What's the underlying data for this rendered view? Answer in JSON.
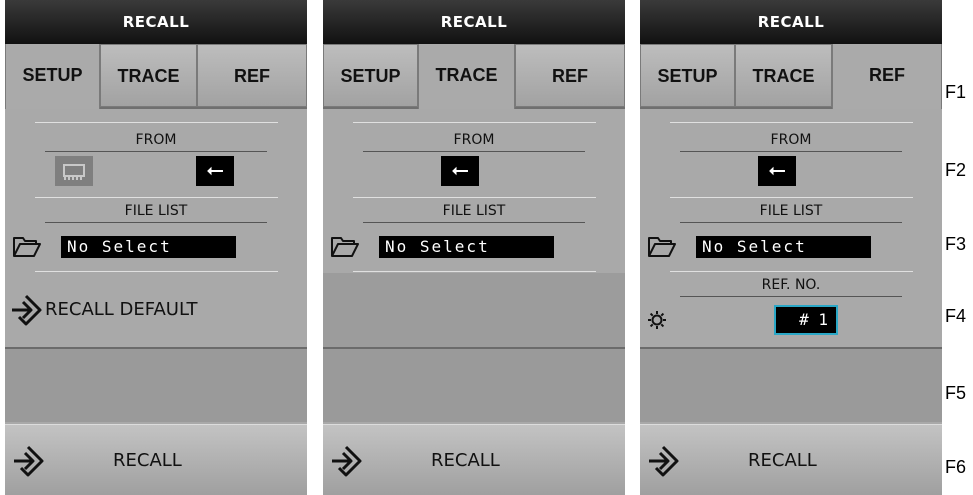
{
  "panels": [
    {
      "title": "RECALL",
      "tabs": [
        "SETUP",
        "TRACE",
        "REF"
      ],
      "from_label": "FROM",
      "file_list_label": "FILE LIST",
      "file_value": "No Select",
      "default_label": "RECALL DEFAULT",
      "recall_label": "RECALL"
    },
    {
      "title": "RECALL",
      "tabs": [
        "SETUP",
        "TRACE",
        "REF"
      ],
      "from_label": "FROM",
      "file_list_label": "FILE LIST",
      "file_value": "No Select",
      "recall_label": "RECALL"
    },
    {
      "title": "RECALL",
      "tabs": [
        "SETUP",
        "TRACE",
        "REF"
      ],
      "from_label": "FROM",
      "file_list_label": "FILE LIST",
      "file_value": "No Select",
      "ref_no_label": "REF. NO.",
      "ref_value": "#  1",
      "recall_label": "RECALL"
    }
  ],
  "function_keys": [
    "F1",
    "F2",
    "F3",
    "F4",
    "F5",
    "F6"
  ],
  "colors": {
    "title_bar": "#111111",
    "panel": "#a9a9a9",
    "ref_box_border": "#2aa7c6"
  },
  "icons": [
    "memory-icon",
    "usb-icon",
    "folder-icon",
    "recall-arrow-icon",
    "gear-icon"
  ]
}
